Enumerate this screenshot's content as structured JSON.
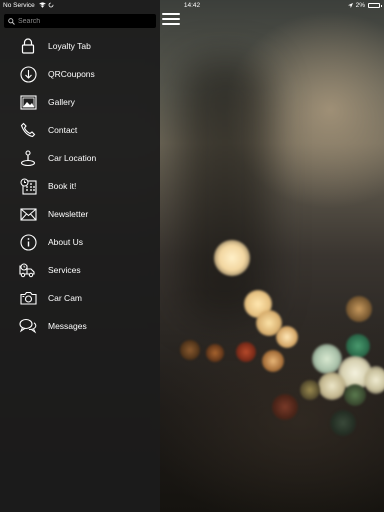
{
  "status_bar": {
    "carrier": "No Service",
    "time": "14:42",
    "battery": "2%",
    "battery_level": 0.02
  },
  "search": {
    "placeholder": "Search"
  },
  "menu": {
    "items": [
      {
        "label": "Loyalty Tab",
        "icon": "lock-icon"
      },
      {
        "label": "QRCoupons",
        "icon": "download-icon"
      },
      {
        "label": "Gallery",
        "icon": "image-icon"
      },
      {
        "label": "Contact",
        "icon": "phone-icon"
      },
      {
        "label": "Car Location",
        "icon": "location-pin-icon"
      },
      {
        "label": "Book it!",
        "icon": "calendar-clock-icon"
      },
      {
        "label": "Newsletter",
        "icon": "envelope-icon"
      },
      {
        "label": "About Us",
        "icon": "info-icon"
      },
      {
        "label": "Services",
        "icon": "truck-icon"
      },
      {
        "label": "Car Cam",
        "icon": "camera-icon"
      },
      {
        "label": "Messages",
        "icon": "chat-bubbles-icon"
      }
    ]
  },
  "colors": {
    "panel": "#1c1c1c",
    "search_field": "#000000",
    "text": "#ffffff"
  }
}
